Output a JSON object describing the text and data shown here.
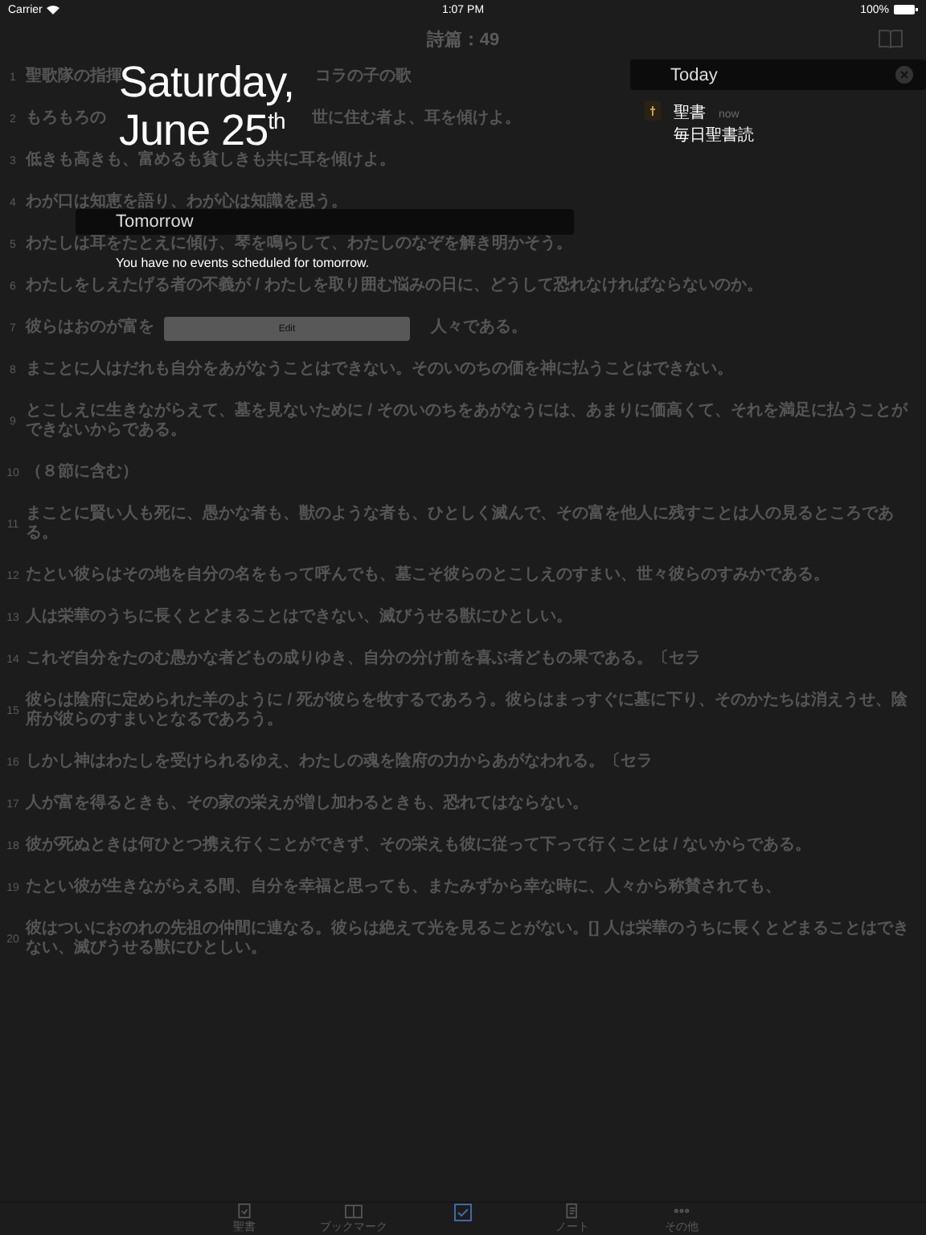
{
  "status_bar": {
    "carrier": "Carrier",
    "time": "1:07 PM",
    "battery": "100%"
  },
  "nav": {
    "title": "詩篇：49"
  },
  "verses": [
    {
      "number": "1",
      "parts": [
        "聖歌隊の指揮",
        "コラの子の歌"
      ]
    },
    {
      "number": "2",
      "parts": [
        "もろもろの",
        "世に住む者よ、耳を傾けよ。"
      ]
    },
    {
      "number": "3",
      "text": "低きも高きも、富めるも貧しきも共に耳を傾けよ。"
    },
    {
      "number": "4",
      "text": "わが口は知恵を語り、わが心は知識を思う。"
    },
    {
      "number": "5",
      "text": "わたしは耳をたとえに傾け、琴を鳴らして、わたしのなぞを解き明かそう。"
    },
    {
      "number": "6",
      "text": "わたしをしえたげる者の不義が / わたしを取り囲む悩みの日に、どうして恐れなければならないのか。"
    },
    {
      "number": "7",
      "parts": [
        "彼らはおのが富を",
        "人々である。"
      ]
    },
    {
      "number": "8",
      "text": "まことに人はだれも自分をあがなうことはできない。そのいのちの価を神に払うことはできない。"
    },
    {
      "number": "9",
      "text": "とこしえに生きながらえて、墓を見ないために / そのいのちをあがなうには、あまりに価高くて、それを満足に払うことができないからである。"
    },
    {
      "number": "10",
      "text": "（８節に含む）"
    },
    {
      "number": "11",
      "text": "まことに賢い人も死に、愚かな者も、獣のような者も、ひとしく滅んで、その富を他人に残すことは人の見るところである。"
    },
    {
      "number": "12",
      "text": "たとい彼らはその地を自分の名をもって呼んでも、墓こそ彼らのとこしえのすまい、世々彼らのすみかである。"
    },
    {
      "number": "13",
      "text": "人は栄華のうちに長くとどまることはできない、滅びうせる獣にひとしい。"
    },
    {
      "number": "14",
      "text": "これぞ自分をたのむ愚かな者どもの成りゆき、自分の分け前を喜ぶ者どもの果である。〔セラ"
    },
    {
      "number": "15",
      "text": "彼らは陰府に定められた羊のように / 死が彼らを牧するであろう。彼らはまっすぐに墓に下り、そのかたちは消えうせ、陰府が彼らのすまいとなるであろう。"
    },
    {
      "number": "16",
      "text": "しかし神はわたしを受けられるゆえ、わたしの魂を陰府の力からあがなわれる。〔セラ"
    },
    {
      "number": "17",
      "text": "人が富を得るときも、その家の栄えが増し加わるときも、恐れてはならない。"
    },
    {
      "number": "18",
      "text": "彼が死ぬときは何ひとつ携え行くことができず、その栄えも彼に従って下って行くことは / ないからである。"
    },
    {
      "number": "19",
      "text": "たとい彼が生きながらえる間、自分を幸福と思っても、またみずから幸な時に、人々から称賛されても、"
    },
    {
      "number": "20",
      "text": "彼はついにおのれの先祖の仲間に連なる。彼らは絶えて光を見ることがない。[] 人は栄華のうちに長くとどまることはできない、滅びうせる獣にひとしい。"
    }
  ],
  "tab_bar": [
    {
      "kind": "bible",
      "label": "聖書",
      "selected": false
    },
    {
      "kind": "bookmark",
      "label": "ブックマーク",
      "selected": false
    },
    {
      "kind": "plan",
      "selected": true
    },
    {
      "kind": "note",
      "label": "ノート",
      "selected": false
    },
    {
      "kind": "more",
      "label": "その他",
      "selected": false
    }
  ],
  "today_view": {
    "date_line_1": "Saturday,",
    "date_line_2": "June 25$^{th}$",
    "tomorrow": {
      "title": "Tomorrow",
      "message": "You have no events scheduled for tomorrow."
    },
    "edit_button": "Edit",
    "today": {
      "title": "Today",
      "notifications": [
        {
          "app": "聖書",
          "time": "now",
          "message": "毎日聖書読"
        }
      ]
    }
  }
}
